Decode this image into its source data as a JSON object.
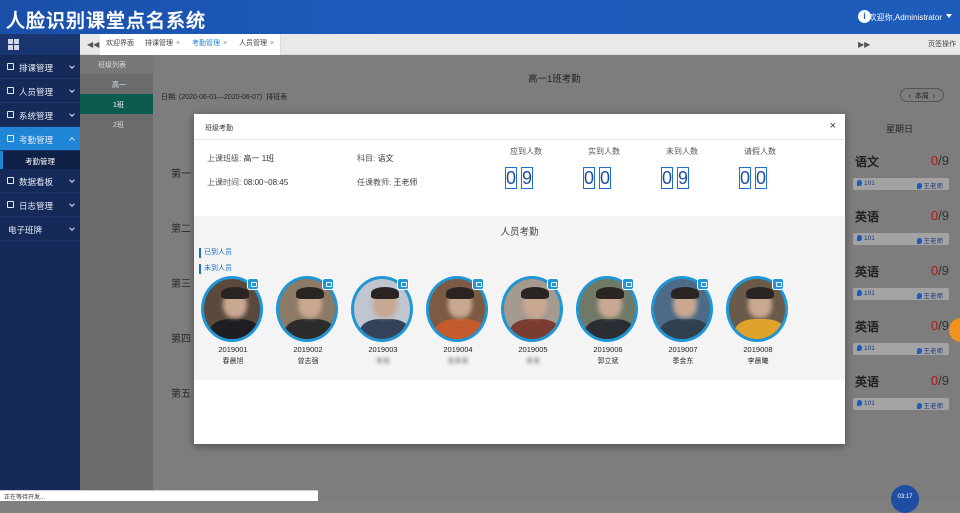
{
  "app": {
    "title": "人脸识别课堂点名系统",
    "welcome": "欢迎你,Administrator",
    "info_icon": "info-icon"
  },
  "sidebar": {
    "items": [
      {
        "label": "排课管理",
        "icon": "calendar-icon"
      },
      {
        "label": "人员管理",
        "icon": "user-icon"
      },
      {
        "label": "系统管理",
        "icon": "settings-icon"
      },
      {
        "label": "考勤管理",
        "icon": "attendance-icon",
        "active": true
      },
      {
        "label": "数据看板",
        "icon": "dashboard-icon"
      },
      {
        "label": "日志管理",
        "icon": "log-icon"
      },
      {
        "label": "电子班牌",
        "icon": ""
      }
    ],
    "submenu": {
      "label": "考勤管理"
    }
  },
  "tabs": {
    "items": [
      {
        "label": "欢迎界面",
        "closable": false
      },
      {
        "label": "排课管理",
        "closable": true
      },
      {
        "label": "考勤管理",
        "closable": true,
        "active": true
      },
      {
        "label": "人员管理",
        "closable": true
      }
    ],
    "page_op": "页签操作"
  },
  "classes": {
    "header": "班级列表",
    "grade": "高一",
    "items": [
      "1班",
      "2班"
    ]
  },
  "main": {
    "title": "高一1班考勤",
    "date_label": "日期:",
    "date_range": "(2020-06-01—2020-06-07)",
    "export": "排班表",
    "week_btn": "本周",
    "sunday": "星期日",
    "slots": [
      "第一",
      "第二",
      "第三",
      "第四",
      "第五"
    ],
    "sunday_courses": [
      {
        "name": "语文",
        "attended": "0",
        "total": "/9",
        "room": "101",
        "teacher": "王老师"
      },
      {
        "name": "英语",
        "attended": "0",
        "total": "/9",
        "room": "101",
        "teacher": "王老师"
      },
      {
        "name": "英语",
        "attended": "0",
        "total": "/9",
        "room": "101",
        "teacher": "王老师"
      },
      {
        "name": "英语",
        "attended": "0",
        "total": "/9",
        "room": "101",
        "teacher": "王老师"
      },
      {
        "name": "英语",
        "attended": "0",
        "total": "/9",
        "room": "101",
        "teacher": "王老师"
      }
    ]
  },
  "modal": {
    "title": "班级考勤",
    "close": "×",
    "class_label": "上课班级:",
    "class_value": "高一 1班",
    "subject_label": "科目:",
    "subject_value": "语文",
    "time_label": "上课时间:",
    "time_value": "08:00~08:45",
    "teacher_label": "任课教师:",
    "teacher_value": "王老师",
    "stats": [
      {
        "label": "应到人数",
        "digits": [
          "0",
          "9"
        ]
      },
      {
        "label": "实到人数",
        "digits": [
          "0",
          "0"
        ]
      },
      {
        "label": "未到人数",
        "digits": [
          "0",
          "9"
        ]
      },
      {
        "label": "请假人数",
        "digits": [
          "0",
          "0"
        ]
      }
    ],
    "section_title": "人员考勤",
    "tag_present": "已到人员",
    "tag_absent": "未到人员",
    "students": [
      {
        "id": "2019001",
        "name": "春晨旭",
        "blur": false,
        "bg": "#5a4a3e",
        "shirt": "#1e1e22"
      },
      {
        "id": "2019002",
        "name": "曾志强",
        "blur": false,
        "bg": "#8a7a66",
        "shirt": "#2b2b2b"
      },
      {
        "id": "2019003",
        "name": "某某",
        "blur": true,
        "bg": "#bfc6cf",
        "shirt": "#34425c"
      },
      {
        "id": "2019004",
        "name": "某某某",
        "blur": true,
        "bg": "#7d5a44",
        "shirt": "#c35a2c"
      },
      {
        "id": "2019005",
        "name": "某某",
        "blur": true,
        "bg": "#a59a90",
        "shirt": "#7a3c30"
      },
      {
        "id": "2019006",
        "name": "郭立斌",
        "blur": false,
        "bg": "#6f7a66",
        "shirt": "#2a2e34"
      },
      {
        "id": "2019007",
        "name": "季金东",
        "blur": false,
        "bg": "#4d6b86",
        "shirt": "#30404e"
      },
      {
        "id": "2019008",
        "name": "李晨曦",
        "blur": false,
        "bg": "#6a5a4a",
        "shirt": "#e0a22a"
      }
    ]
  },
  "statusbar": "正在等待开发...",
  "float_button": "03:17"
}
